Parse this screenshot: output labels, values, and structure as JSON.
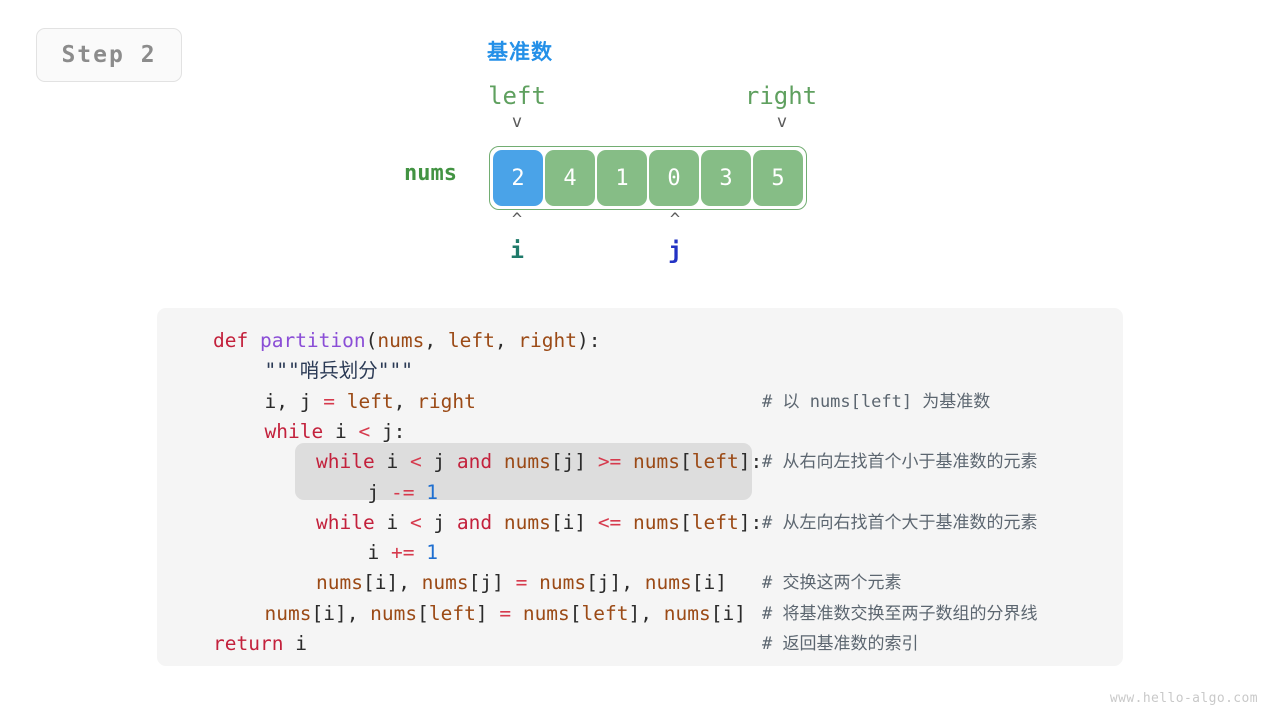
{
  "step_badge": {
    "label": "Step 2"
  },
  "diagram": {
    "pivot_label": "基准数",
    "nums_label": "nums",
    "left_label": "left",
    "right_label": "right",
    "down_caret": "v",
    "up_caret": "^",
    "pointer_i": "i",
    "pointer_j": "j",
    "cells": [
      {
        "value": "2",
        "highlight": true
      },
      {
        "value": "4",
        "highlight": false
      },
      {
        "value": "1",
        "highlight": false
      },
      {
        "value": "0",
        "highlight": false
      },
      {
        "value": "3",
        "highlight": false
      },
      {
        "value": "5",
        "highlight": false
      }
    ],
    "colors": {
      "pivot_cell": "#4aa3e8",
      "cell": "#86bd86",
      "box_border": "#72ad72",
      "nums_label": "#429342",
      "bound_label": "#5fa05f",
      "pointer_i": "#1f7a6a",
      "pointer_j": "#2333c4",
      "pivot_text": "#2490e8"
    }
  },
  "code": {
    "language": "python",
    "lines": [
      {
        "indent": 0,
        "tokens": [
          {
            "t": "def ",
            "c": "kw"
          },
          {
            "t": "partition",
            "c": "fn"
          },
          {
            "t": "(",
            "c": "pl"
          },
          {
            "t": "nums",
            "c": "var"
          },
          {
            "t": ", ",
            "c": "pl"
          },
          {
            "t": "left",
            "c": "var"
          },
          {
            "t": ", ",
            "c": "pl"
          },
          {
            "t": "right",
            "c": "var"
          },
          {
            "t": "):",
            "c": "pl"
          }
        ]
      },
      {
        "indent": 1,
        "tokens": [
          {
            "t": "\"\"\"哨兵划分\"\"\"",
            "c": "str"
          }
        ]
      },
      {
        "indent": 1,
        "tokens": [
          {
            "t": "i",
            "c": "pl"
          },
          {
            "t": ", ",
            "c": "pl"
          },
          {
            "t": "j ",
            "c": "pl"
          },
          {
            "t": "= ",
            "c": "op"
          },
          {
            "t": "left",
            "c": "var"
          },
          {
            "t": ", ",
            "c": "pl"
          },
          {
            "t": "right",
            "c": "var"
          }
        ]
      },
      {
        "indent": 1,
        "tokens": [
          {
            "t": "while ",
            "c": "kw"
          },
          {
            "t": "i ",
            "c": "pl"
          },
          {
            "t": "< ",
            "c": "op"
          },
          {
            "t": "j:",
            "c": "pl"
          }
        ]
      },
      {
        "indent": 2,
        "tokens": [
          {
            "t": "while ",
            "c": "kw"
          },
          {
            "t": "i ",
            "c": "pl"
          },
          {
            "t": "< ",
            "c": "op"
          },
          {
            "t": "j ",
            "c": "pl"
          },
          {
            "t": "and ",
            "c": "kw"
          },
          {
            "t": "nums",
            "c": "var"
          },
          {
            "t": "[j] ",
            "c": "pl"
          },
          {
            "t": ">= ",
            "c": "op"
          },
          {
            "t": "nums",
            "c": "var"
          },
          {
            "t": "[",
            "c": "pl"
          },
          {
            "t": "left",
            "c": "var"
          },
          {
            "t": "]:",
            "c": "pl"
          }
        ]
      },
      {
        "indent": 3,
        "tokens": [
          {
            "t": "j ",
            "c": "pl"
          },
          {
            "t": "-= ",
            "c": "op"
          },
          {
            "t": "1",
            "c": "num"
          }
        ]
      },
      {
        "indent": 2,
        "tokens": [
          {
            "t": "while ",
            "c": "kw"
          },
          {
            "t": "i ",
            "c": "pl"
          },
          {
            "t": "< ",
            "c": "op"
          },
          {
            "t": "j ",
            "c": "pl"
          },
          {
            "t": "and ",
            "c": "kw"
          },
          {
            "t": "nums",
            "c": "var"
          },
          {
            "t": "[i] ",
            "c": "pl"
          },
          {
            "t": "<= ",
            "c": "op"
          },
          {
            "t": "nums",
            "c": "var"
          },
          {
            "t": "[",
            "c": "pl"
          },
          {
            "t": "left",
            "c": "var"
          },
          {
            "t": "]:",
            "c": "pl"
          }
        ]
      },
      {
        "indent": 3,
        "tokens": [
          {
            "t": "i ",
            "c": "pl"
          },
          {
            "t": "+= ",
            "c": "op"
          },
          {
            "t": "1",
            "c": "num"
          }
        ]
      },
      {
        "indent": 2,
        "tokens": [
          {
            "t": "nums",
            "c": "var"
          },
          {
            "t": "[i], ",
            "c": "pl"
          },
          {
            "t": "nums",
            "c": "var"
          },
          {
            "t": "[j] ",
            "c": "pl"
          },
          {
            "t": "= ",
            "c": "op"
          },
          {
            "t": "nums",
            "c": "var"
          },
          {
            "t": "[j], ",
            "c": "pl"
          },
          {
            "t": "nums",
            "c": "var"
          },
          {
            "t": "[i]",
            "c": "pl"
          }
        ]
      },
      {
        "indent": 1,
        "tokens": [
          {
            "t": "nums",
            "c": "var"
          },
          {
            "t": "[i], ",
            "c": "pl"
          },
          {
            "t": "nums",
            "c": "var"
          },
          {
            "t": "[",
            "c": "pl"
          },
          {
            "t": "left",
            "c": "var"
          },
          {
            "t": "] ",
            "c": "pl"
          },
          {
            "t": "= ",
            "c": "op"
          },
          {
            "t": "nums",
            "c": "var"
          },
          {
            "t": "[",
            "c": "pl"
          },
          {
            "t": "left",
            "c": "var"
          },
          {
            "t": "], ",
            "c": "pl"
          },
          {
            "t": "nums",
            "c": "var"
          },
          {
            "t": "[i]",
            "c": "pl"
          }
        ]
      },
      {
        "indent": 0,
        "tokens": [
          {
            "t": "return ",
            "c": "kw"
          },
          {
            "t": "i",
            "c": "pl"
          }
        ]
      }
    ],
    "comments": [
      {
        "line": 2,
        "text": "# 以 nums[left] 为基准数"
      },
      {
        "line": 4,
        "text": "# 从右向左找首个小于基准数的元素"
      },
      {
        "line": 6,
        "text": "# 从左向右找首个大于基准数的元素"
      },
      {
        "line": 8,
        "text": "# 交换这两个元素"
      },
      {
        "line": 9,
        "text": "# 将基准数交换至两子数组的分界线"
      },
      {
        "line": 10,
        "text": "# 返回基准数的索引"
      }
    ],
    "highlight_lines": [
      4,
      5
    ]
  },
  "watermark": {
    "text": "www.hello-algo.com"
  }
}
